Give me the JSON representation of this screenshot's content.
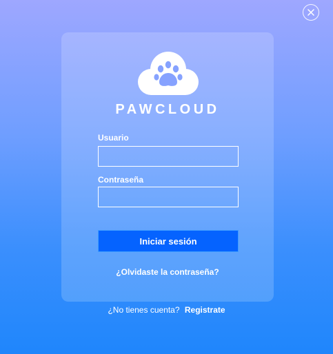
{
  "window": {
    "close_icon": "close-icon"
  },
  "brand": {
    "logo_icon": "paw-cloud-icon",
    "name": "PAWCLOUD"
  },
  "form": {
    "username_label": "Usuario",
    "username_value": "",
    "password_label": "Contraseña",
    "password_value": "",
    "login_button": "Iniciar sesión",
    "forgot_link": "¿Olvidaste la contraseña?"
  },
  "signup": {
    "prompt": "¿No tienes cuenta?",
    "link": "Registrate"
  },
  "colors": {
    "background_top": "#9ea7ff",
    "background_bottom": "#1f86fc",
    "button": "#0563ff",
    "text": "#ffffff"
  }
}
